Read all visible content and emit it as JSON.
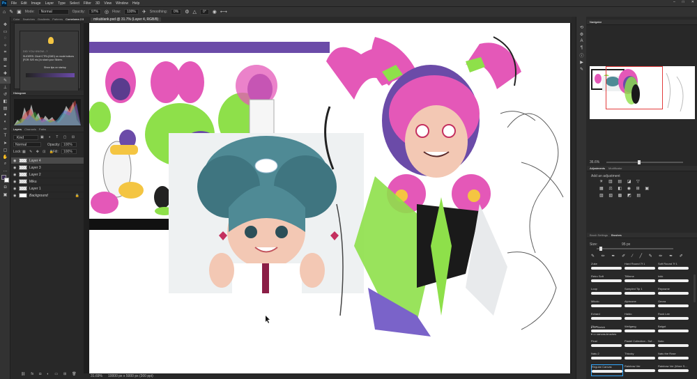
{
  "menubar": {
    "logo": "Ps",
    "items": [
      "File",
      "Edit",
      "Image",
      "Layer",
      "Type",
      "Select",
      "Filter",
      "3D",
      "View",
      "Window",
      "Help"
    ],
    "window_controls": [
      "–",
      "□",
      "✕"
    ]
  },
  "options": {
    "mode_label": "Mode:",
    "mode_value": "Normal",
    "opacity_label": "Opacity:",
    "opacity_value": "97%",
    "flow_label": "Flow:",
    "flow_value": "100%",
    "smoothing_label": "Smoothing:",
    "smoothing_value": "0%",
    "angle_value": "0°"
  },
  "left_panels": {
    "tabs": [
      "Color",
      "Swatches",
      "Gradients",
      "Patterns",
      "Comelorea 2.5"
    ],
    "tip": {
      "title": "DID YOU KNOW...?",
      "text": "SLIDERS: Click+CTRL(CMD) on mode buttons [FOR: B/E etc.] to slash your Sliders.",
      "show_tips": "Show tips on startup"
    },
    "histogram_title": "Histogram",
    "layers_tabs": [
      "Layers",
      "Channels",
      "Paths"
    ],
    "kind_label": "Kind",
    "blend_mode": "Normal",
    "opacity_label": "Opacity:",
    "opacity_value": "100%",
    "lock_label": "Lock:",
    "fill_label": "Fill:",
    "fill_value": "100%",
    "layers": [
      {
        "name": "Layer 4",
        "selected": true
      },
      {
        "name": "Layer 3",
        "selected": false
      },
      {
        "name": "Layer 2",
        "selected": false
      },
      {
        "name": "Miku",
        "selected": false
      },
      {
        "name": "Layer 1",
        "selected": false
      },
      {
        "name": "Background",
        "selected": false
      }
    ]
  },
  "document": {
    "tab_title": "mikublank.psd @ 31.7% (Layer 4, RGB/8)"
  },
  "status": {
    "zoom": "31.69%",
    "doc_size": "10000 px x 5000 px (300 ppi)"
  },
  "right_panels": {
    "navigator_title": "Navigator",
    "nav_zoom": "36.6%",
    "adjustments_tabs": [
      "Adjustments",
      "Modificator"
    ],
    "add_adjustment": "Add an adjustment",
    "brush_tabs": [
      "Brush Settings",
      "Brushes"
    ],
    "size_label": "Size:",
    "size_value": "95 px",
    "brushes": [
      {
        "name": "Zuke"
      },
      {
        "name": "Hard Round 7f 1"
      },
      {
        "name": "Soft Round 7f 1"
      },
      {
        "name": "Retro Soft"
      },
      {
        "name": "Tilfieme"
      },
      {
        "name": "Inkk"
      },
      {
        "name": "Loop"
      },
      {
        "name": "Sampled Tip 1"
      },
      {
        "name": "Repssme"
      },
      {
        "name": "Mikolo"
      },
      {
        "name": "Alphcone"
      },
      {
        "name": "Geora"
      },
      {
        "name": "Echard"
      },
      {
        "name": "Haldo"
      },
      {
        "name": "Rock Lee"
      },
      {
        "name": "Silva"
      },
      {
        "name": "Wellgang"
      },
      {
        "name": "Balgot"
      }
    ],
    "folder_sketch": "Sketch",
    "folder_canvas": "canvas-brushes",
    "brushes2": [
      {
        "name": "Final"
      },
      {
        "name": "Pastel Collection - Sof..."
      },
      {
        "name": "Noto"
      },
      {
        "name": "Natu 2"
      },
      {
        "name": "Thiccky"
      },
      {
        "name": "Natu the Rose"
      },
      {
        "name": "Regular Canvas",
        "selected": true
      },
      {
        "name": "Rainbow Ver"
      },
      {
        "name": "Rainbow Ver (Wore S..."
      }
    ]
  },
  "colors": {
    "ui_dark": "#282828",
    "accent": "#31a8ff",
    "purple": "#6b4ba8",
    "pink": "#e458b8",
    "green": "#8ee04a",
    "teal": "#4f8a95"
  }
}
